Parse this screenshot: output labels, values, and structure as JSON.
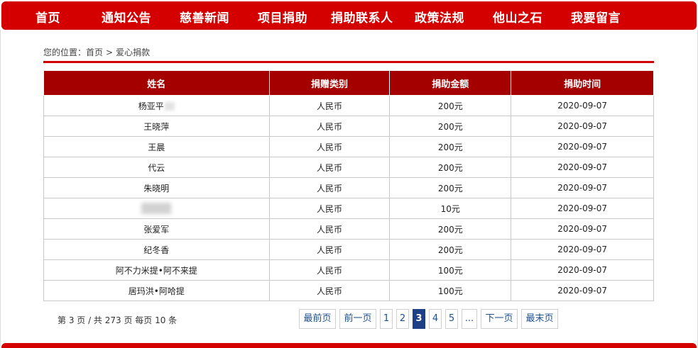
{
  "nav": {
    "items": [
      "首页",
      "通知公告",
      "慈善新闻",
      "项目捐助",
      "捐助联系人",
      "政策法规",
      "他山之石",
      "我要留言"
    ]
  },
  "breadcrumb": {
    "prefix": "您的位置：",
    "home": "首页",
    "separator": ">",
    "current": "爱心捐款"
  },
  "table": {
    "headers": [
      "姓名",
      "捐赠类别",
      "捐助金额",
      "捐助时间"
    ],
    "rows": [
      {
        "name": "杨亚平",
        "type": "人民币",
        "amount": "200元",
        "date": "2020-09-07"
      },
      {
        "name": "王晓萍",
        "type": "人民币",
        "amount": "200元",
        "date": "2020-09-07"
      },
      {
        "name": "王晨",
        "type": "人民币",
        "amount": "200元",
        "date": "2020-09-07"
      },
      {
        "name": "代云",
        "type": "人民币",
        "amount": "200元",
        "date": "2020-09-07"
      },
      {
        "name": "朱晓明",
        "type": "人民币",
        "amount": "200元",
        "date": "2020-09-07"
      },
      {
        "name": "",
        "type": "人民币",
        "amount": "10元",
        "date": "2020-09-07"
      },
      {
        "name": "张爱军",
        "type": "人民币",
        "amount": "200元",
        "date": "2020-09-07"
      },
      {
        "name": "纪冬香",
        "type": "人民币",
        "amount": "200元",
        "date": "2020-09-07"
      },
      {
        "name": "阿不力米提•阿不来提",
        "type": "人民币",
        "amount": "100元",
        "date": "2020-09-07"
      },
      {
        "name": "居玛洪•阿哈提",
        "type": "人民币",
        "amount": "100元",
        "date": "2020-09-07"
      }
    ]
  },
  "pagination": {
    "info": "第 3 页 / 共 273 页 每页 10 条",
    "first": "最前页",
    "prev": "前一页",
    "pages": [
      "1",
      "2",
      "3",
      "4",
      "5"
    ],
    "current_page": "3",
    "ellipsis": "...",
    "next": "下一页",
    "last": "最末页"
  },
  "colors": {
    "nav_red": "#d40000",
    "header_dark_red": "#a50000",
    "pager_active": "#1f3f86",
    "pager_link": "#1e4f8f"
  }
}
